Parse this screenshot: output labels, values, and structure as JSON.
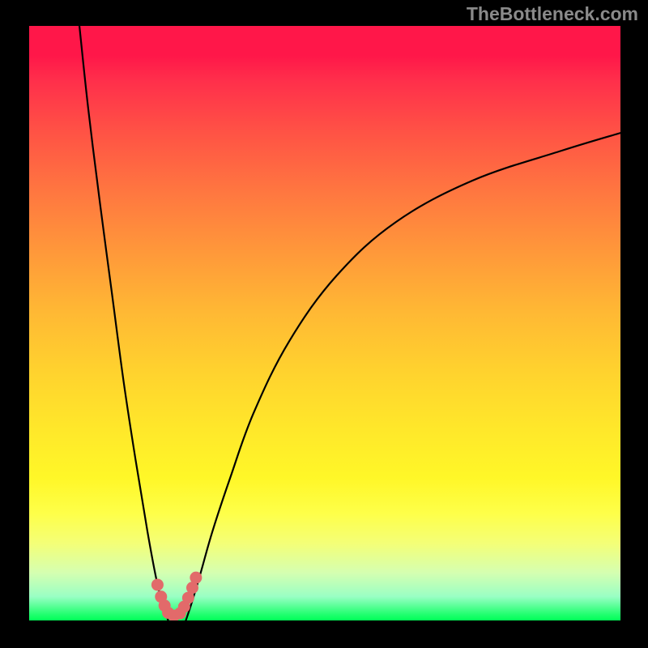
{
  "watermark": "TheBottleneck.com",
  "chart_data": {
    "type": "line",
    "title": "",
    "xlabel": "",
    "ylabel": "",
    "xlim": [
      0,
      100
    ],
    "ylim": [
      0,
      100
    ],
    "grid": false,
    "background_gradient": {
      "direction": "vertical",
      "stops": [
        {
          "pos": 0.0,
          "color": "#ff1749"
        },
        {
          "pos": 0.5,
          "color": "#ffc931"
        },
        {
          "pos": 0.8,
          "color": "#fcff3a"
        },
        {
          "pos": 1.0,
          "color": "#00ff57"
        }
      ]
    },
    "series": [
      {
        "name": "left-branch",
        "x": [
          8.5,
          10,
          12,
          14,
          16,
          18,
          20,
          21.5,
          22.5,
          23.5
        ],
        "y": [
          100,
          86,
          70,
          55,
          40,
          27,
          15,
          7,
          3,
          0
        ],
        "color": "#000000"
      },
      {
        "name": "right-branch",
        "x": [
          26.5,
          27.5,
          29,
          31,
          34,
          38,
          44,
          52,
          62,
          75,
          90,
          100
        ],
        "y": [
          0,
          3,
          8,
          15,
          24,
          35,
          47,
          58,
          67,
          74,
          79,
          82
        ],
        "color": "#000000"
      },
      {
        "name": "marker-cluster",
        "type": "scatter",
        "color": "#e26a6a",
        "x": [
          21.7,
          22.3,
          22.9,
          23.5,
          24.5,
          25.5,
          26.2,
          26.9,
          27.6,
          28.2
        ],
        "y": [
          6.0,
          4.0,
          2.5,
          1.3,
          0.8,
          1.2,
          2.3,
          3.8,
          5.5,
          7.2
        ]
      }
    ],
    "annotations": []
  }
}
